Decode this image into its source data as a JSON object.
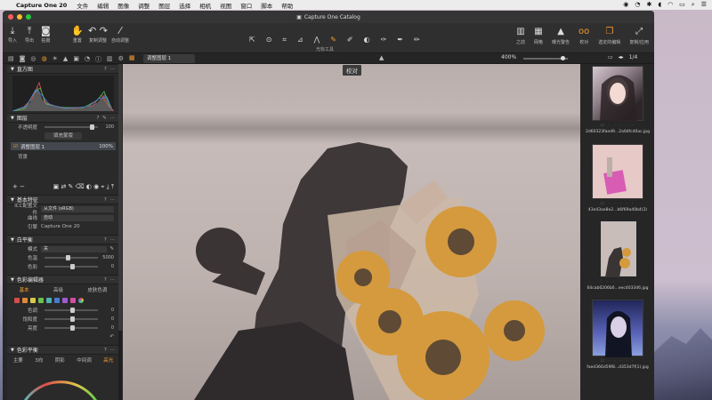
{
  "menubar": {
    "app_name": "Capture One 20",
    "items": [
      "文件",
      "编辑",
      "图像",
      "调整",
      "图层",
      "选择",
      "相机",
      "视图",
      "窗口",
      "脚本",
      "帮助"
    ]
  },
  "window": {
    "title": "Capture One Catalog"
  },
  "toolbar": {
    "left_groups": [
      {
        "icon": "import-icon",
        "label": "导入"
      },
      {
        "icon": "export-icon",
        "label": "导出"
      },
      {
        "icon": "capture-icon",
        "label": "拍摄"
      },
      {
        "icon": "reset-icon",
        "label": "重置"
      },
      {
        "icon": "copy-adjust-icon",
        "label": "复制调整"
      },
      {
        "icon": "auto-adjust-icon",
        "label": "自动调整"
      }
    ],
    "cursor_tools_label": "光标工具",
    "right_groups": [
      {
        "icon": "before-after-icon",
        "label": "之前"
      },
      {
        "icon": "grid-icon",
        "label": "网格"
      },
      {
        "icon": "exposure-warning-icon",
        "label": "曝光警告"
      },
      {
        "icon": "proof-icon",
        "label": "校对"
      },
      {
        "icon": "recent-adjust-icon",
        "label": "选定的编辑"
      },
      {
        "icon": "copy-apply-icon",
        "label": "复制/应用"
      }
    ]
  },
  "subbar": {
    "viewer_select": "调整图层 1",
    "zoom": "400%",
    "count": "1/4"
  },
  "viewer": {
    "proof_label": "校对"
  },
  "left_panel": {
    "histogram": {
      "title": "直方图"
    },
    "layers": {
      "title": "图层",
      "opacity_label": "不透明度",
      "opacity_value": "100",
      "fill_button": "填充蒙版",
      "layer_name": "调整图层 1",
      "layer_opacity": "100%",
      "background": "背景"
    },
    "basic": {
      "title": "基本特征",
      "icc_label": "ICC配置文件",
      "icc_value": "从文件 (sRGB)",
      "curve_label": "曲线",
      "curve_value": "自动",
      "engine_label": "引擎",
      "engine_value": "Capture One 20"
    },
    "white_balance": {
      "title": "白平衡",
      "mode_label": "模式",
      "mode_value": "关",
      "temp_label": "色温",
      "temp_value": "5000",
      "tint_label": "色彩",
      "tint_value": "0"
    },
    "color_editor": {
      "title": "色彩编辑器",
      "tabs": [
        "基本",
        "高级",
        "皮肤色调"
      ],
      "swatch_colors": [
        "#d94b4b",
        "#e2883a",
        "#d9c94a",
        "#6fbf4e",
        "#4fb3b3",
        "#4a78d0",
        "#9b5ccf",
        "#d14fa0"
      ],
      "hue_label": "色调",
      "hue_value": "0",
      "sat_label": "饱和度",
      "sat_value": "0",
      "light_label": "亮度",
      "light_value": "0"
    },
    "color_balance": {
      "title": "色彩平衡",
      "tabs": [
        "主要",
        "3向",
        "阴影",
        "中间调",
        "高光"
      ]
    }
  },
  "browser": {
    "thumbnails": [
      {
        "name": "2d60323faed9...2a0dfcd0ac.jpg"
      },
      {
        "name": "43e43ae8e2...b6f69a40b4(3)"
      },
      {
        "name": "64cab6206b0...eec403346.jpg"
      },
      {
        "name": "faed366d59f8...d353d7f(1).jpg"
      }
    ]
  }
}
